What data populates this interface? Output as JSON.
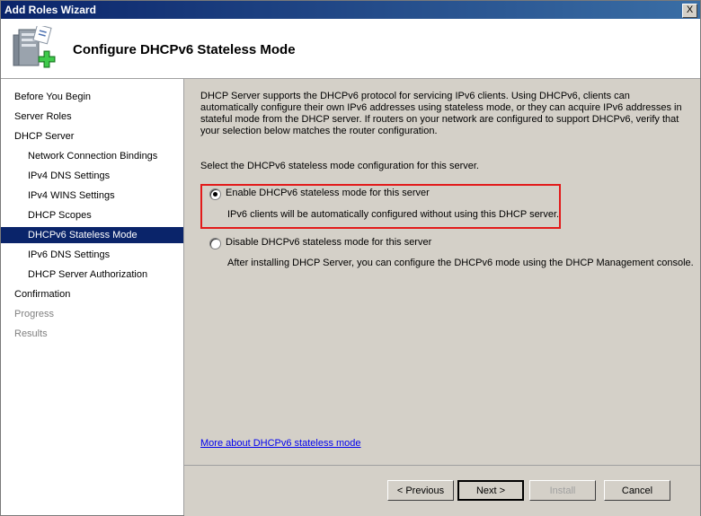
{
  "window": {
    "title": "Add Roles Wizard",
    "close_label": "X"
  },
  "header": {
    "title": "Configure DHCPv6 Stateless Mode",
    "icon": "server-add-icon"
  },
  "sidebar": {
    "items": [
      {
        "label": "Before You Begin"
      },
      {
        "label": "Server Roles"
      },
      {
        "label": "DHCP Server"
      },
      {
        "label": "Network Connection Bindings"
      },
      {
        "label": "IPv4 DNS Settings"
      },
      {
        "label": "IPv4 WINS Settings"
      },
      {
        "label": "DHCP Scopes"
      },
      {
        "label": "DHCPv6 Stateless Mode"
      },
      {
        "label": "IPv6 DNS Settings"
      },
      {
        "label": "DHCP Server Authorization"
      },
      {
        "label": "Confirmation"
      },
      {
        "label": "Progress"
      },
      {
        "label": "Results"
      }
    ]
  },
  "content": {
    "description": "DHCP Server supports the DHCPv6 protocol for servicing IPv6 clients. Using DHCPv6, clients can automatically configure their own IPv6 addresses using stateless mode, or they can acquire IPv6 addresses in stateful mode from the DHCP server. If routers on your network are configured to support DHCPv6, verify that your selection below matches the router configuration.",
    "prompt": "Select the DHCPv6 stateless mode configuration for this server.",
    "options": [
      {
        "label": "Enable DHCPv6 stateless mode for this server",
        "note": "IPv6 clients will be automatically configured without using this DHCP server.",
        "selected": true
      },
      {
        "label": "Disable DHCPv6 stateless mode for this server",
        "note": "After installing DHCP Server, you can configure the DHCPv6 mode using the DHCP Management console.",
        "selected": false
      }
    ],
    "more_link": "More about DHCPv6 stateless mode"
  },
  "footer": {
    "previous_label": "< Previous",
    "next_label": "Next >",
    "install_label": "Install",
    "cancel_label": "Cancel"
  },
  "colors": {
    "accent": "#0a246a",
    "highlight": "#e21a1a",
    "link": "#0000ee"
  }
}
